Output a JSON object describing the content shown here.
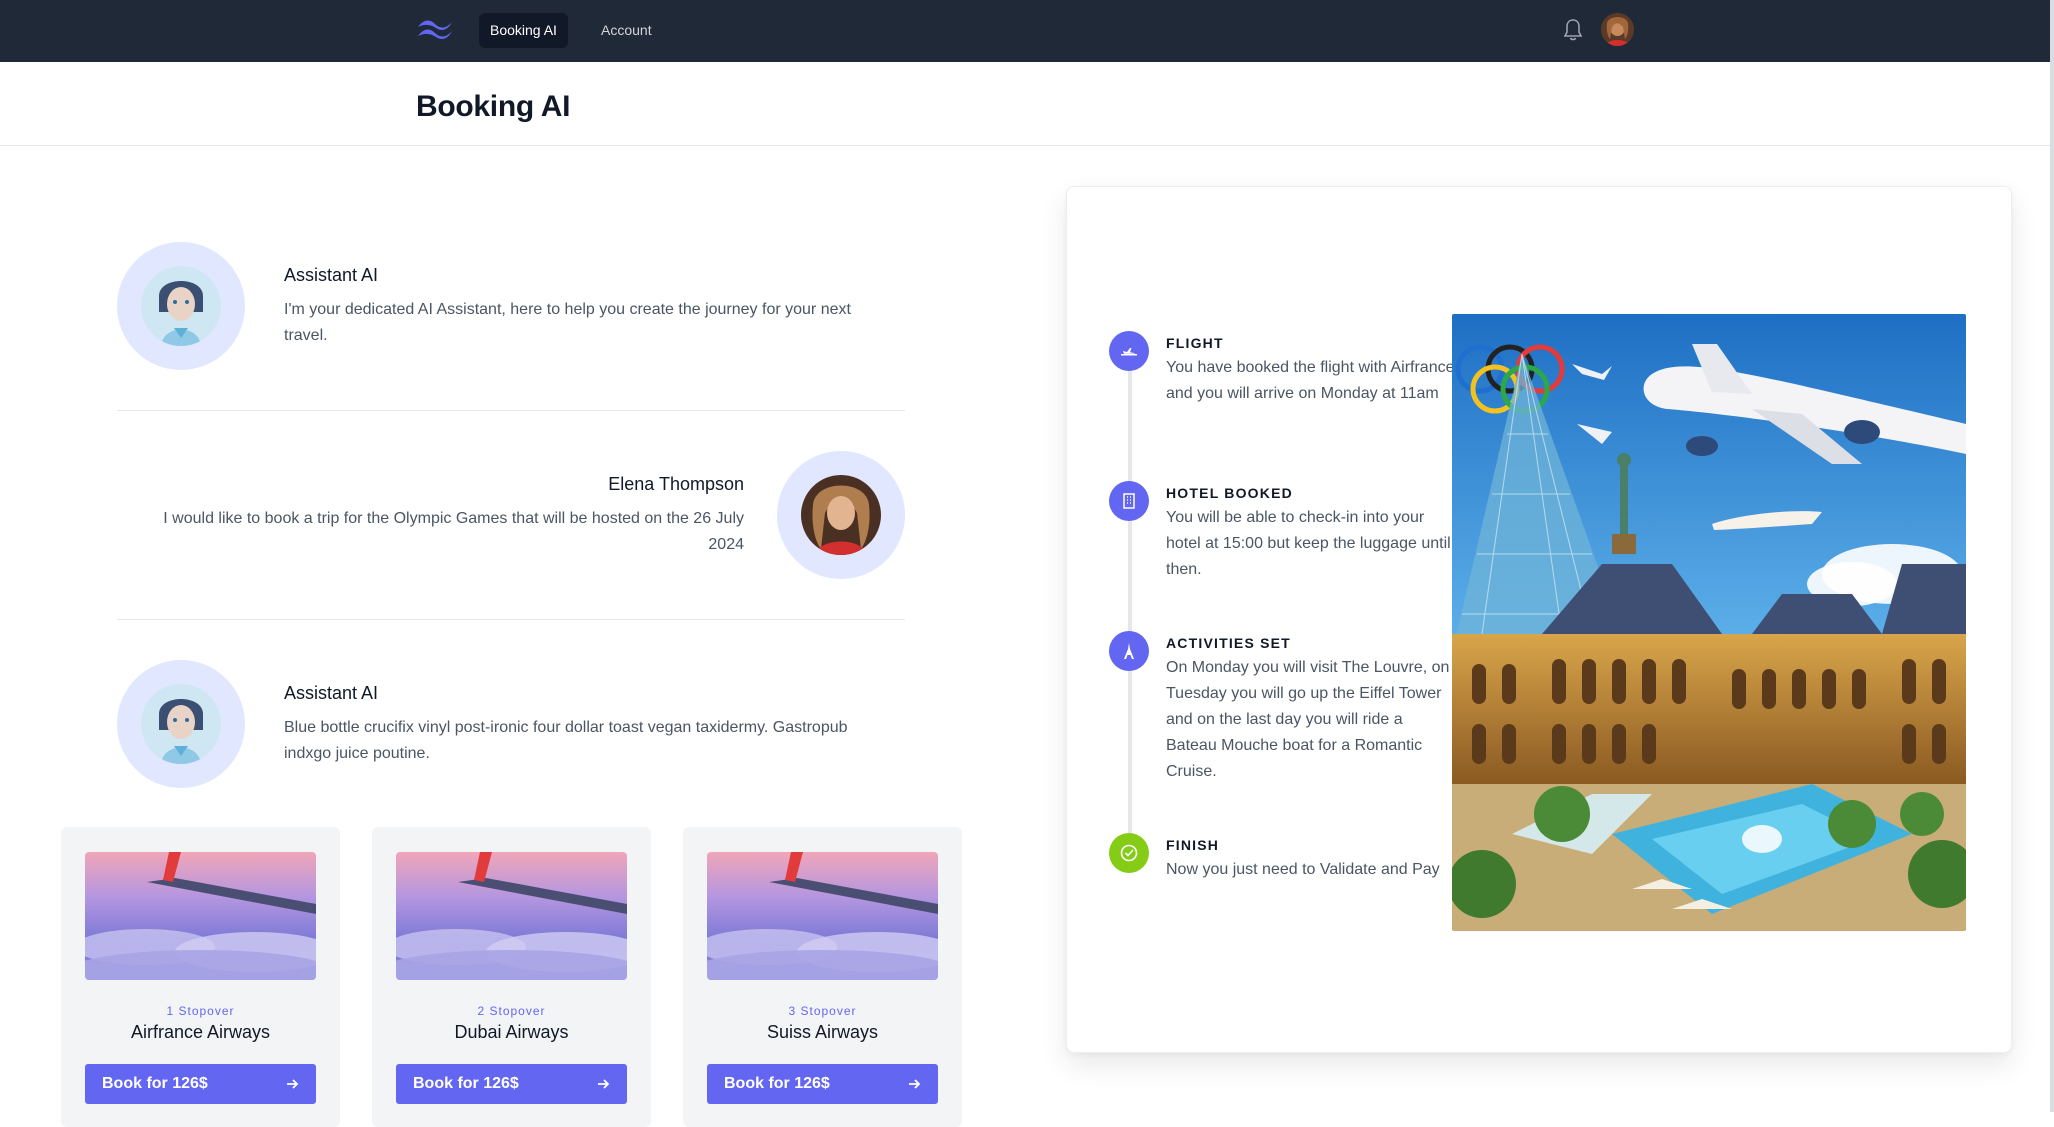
{
  "nav": {
    "tabs": [
      {
        "label": "Booking AI",
        "active": true
      },
      {
        "label": "Account",
        "active": false
      }
    ],
    "logo_icon": "tailwind-wave-logo",
    "notification_icon": "bell-icon",
    "accent_color": "#6366f1"
  },
  "header": {
    "title": "Booking AI"
  },
  "chat": {
    "messages": [
      {
        "sender": "Assistant AI",
        "text": "I'm your dedicated AI Assistant, here to help you create the journey for your next travel.",
        "avatar": "robot-avatar"
      },
      {
        "sender": "Elena Thompson",
        "text": "I would like to book a trip for the Olympic Games that will be hosted on the 26 July 2024",
        "avatar": "user-avatar"
      },
      {
        "sender": "Assistant AI",
        "text": "Blue bottle crucifix vinyl post-ironic four dollar toast vegan taxidermy. Gastropub indxgo juice poutine.",
        "avatar": "robot-avatar"
      }
    ]
  },
  "flights": [
    {
      "stopover": "1 Stopover",
      "airline": "Airfrance Airways",
      "button": "Book for 126$"
    },
    {
      "stopover": "2 Stopover",
      "airline": "Dubai Airways",
      "button": "Book for 126$"
    },
    {
      "stopover": "3 Stopover",
      "airline": "Suiss Airways",
      "button": "Book for 126$"
    }
  ],
  "itinerary": {
    "steps": [
      {
        "title": "FLIGHT",
        "desc": "You have booked the flight with Airfrance and you will arrive on Monday at 11am",
        "icon": "plane-icon"
      },
      {
        "title": "HOTEL BOOKED",
        "desc": "You will be able to check-in into your hotel at 15:00 but keep the luggage until then.",
        "icon": "building-icon"
      },
      {
        "title": "ACTIVITIES SET",
        "desc": "On Monday you will visit The Louvre, on Tuesday you will go up the Eiffel Tower and on the last day you will ride a Bateau Mouche boat for a Romantic Cruise.",
        "icon": "eiffel-tower-icon"
      },
      {
        "title": "FINISH",
        "desc": "Now you just need to Validate and Pay",
        "icon": "check-circle-icon"
      }
    ]
  }
}
